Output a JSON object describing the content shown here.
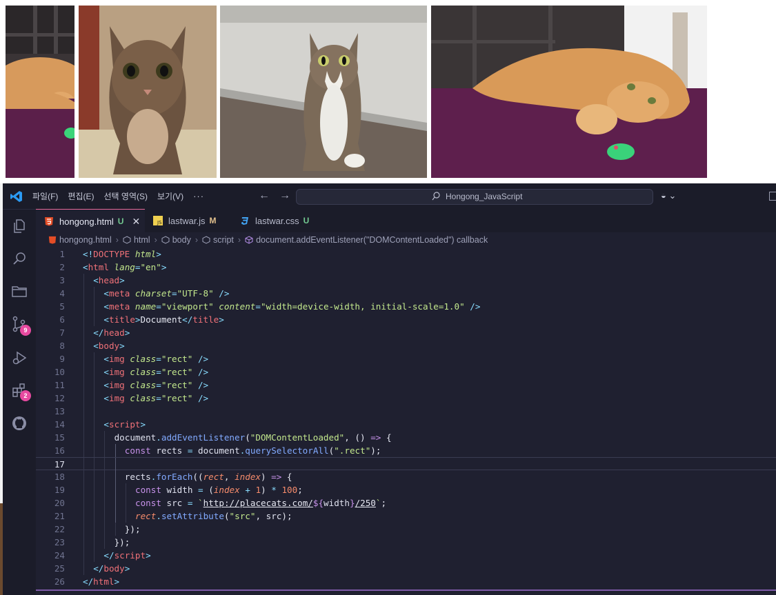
{
  "images": [
    {
      "alt": "orange cat lying on purple rug with green toy mouse (cropped)"
    },
    {
      "alt": "tabby cat looking at camera"
    },
    {
      "alt": "tabby and white cat sitting"
    },
    {
      "alt": "orange cat lying on purple rug with green toy mouse"
    }
  ],
  "titlebar": {
    "menu": [
      "파일(F)",
      "편집(E)",
      "선택 영역(S)",
      "보기(V)",
      "···"
    ],
    "command_center": "Hongong_JavaScript",
    "copilot_chevron": "⌄"
  },
  "activity_bar": {
    "source_control_badge": "9",
    "extensions_badge": "2"
  },
  "tabs": [
    {
      "label": "hongong.html",
      "status": "U",
      "status_color": "#73c991",
      "icon": "html5-icon",
      "active": true
    },
    {
      "label": "lastwar.js",
      "status": "M",
      "status_color": "#e2c08d",
      "icon": "js-icon",
      "active": false
    },
    {
      "label": "lastwar.css",
      "status": "U",
      "status_color": "#73c991",
      "icon": "css3-icon",
      "active": false
    }
  ],
  "breadcrumb": [
    "hongong.html",
    "html",
    "body",
    "script",
    "document.addEventListener(\"DOMContentLoaded\") callback"
  ],
  "colors": {
    "editor_bg": "#1f2030",
    "tag": "#f07178",
    "attribute": "#c3e88d",
    "keyword": "#c792ea",
    "function": "#82aaff",
    "accent": "#e76a9a"
  },
  "code": {
    "current_line": 17,
    "lines": [
      {
        "n": "1",
        "indent": 0,
        "tokens": [
          [
            "p",
            "<!"
          ],
          [
            "dt",
            "DOCTYPE"
          ],
          [
            "txt",
            " "
          ],
          [
            "attr",
            "html"
          ],
          [
            "p",
            ">"
          ]
        ]
      },
      {
        "n": "2",
        "indent": 0,
        "tokens": [
          [
            "p",
            "<"
          ],
          [
            "tag",
            "html"
          ],
          [
            "txt",
            " "
          ],
          [
            "attr",
            "lang"
          ],
          [
            "p",
            "="
          ],
          [
            "str",
            "\"en\""
          ],
          [
            "p",
            ">"
          ]
        ]
      },
      {
        "n": "3",
        "indent": 1,
        "tokens": [
          [
            "p",
            "<"
          ],
          [
            "tag",
            "head"
          ],
          [
            "p",
            ">"
          ]
        ]
      },
      {
        "n": "4",
        "indent": 2,
        "tokens": [
          [
            "p",
            "<"
          ],
          [
            "tag",
            "meta"
          ],
          [
            "txt",
            " "
          ],
          [
            "attr",
            "charset"
          ],
          [
            "p",
            "="
          ],
          [
            "str",
            "\"UTF-8\""
          ],
          [
            "txt",
            " "
          ],
          [
            "p",
            "/>"
          ]
        ]
      },
      {
        "n": "5",
        "indent": 2,
        "tokens": [
          [
            "p",
            "<"
          ],
          [
            "tag",
            "meta"
          ],
          [
            "txt",
            " "
          ],
          [
            "attr",
            "name"
          ],
          [
            "p",
            "="
          ],
          [
            "str",
            "\"viewport\""
          ],
          [
            "txt",
            " "
          ],
          [
            "attr",
            "content"
          ],
          [
            "p",
            "="
          ],
          [
            "str",
            "\"width=device-width, initial-scale=1.0\""
          ],
          [
            "txt",
            " "
          ],
          [
            "p",
            "/>"
          ]
        ]
      },
      {
        "n": "6",
        "indent": 2,
        "tokens": [
          [
            "p",
            "<"
          ],
          [
            "tag",
            "title"
          ],
          [
            "p",
            ">"
          ],
          [
            "txt",
            "Document"
          ],
          [
            "p",
            "</"
          ],
          [
            "tag",
            "title"
          ],
          [
            "p",
            ">"
          ]
        ]
      },
      {
        "n": "7",
        "indent": 1,
        "tokens": [
          [
            "p",
            "</"
          ],
          [
            "tag",
            "head"
          ],
          [
            "p",
            ">"
          ]
        ]
      },
      {
        "n": "8",
        "indent": 1,
        "tokens": [
          [
            "p",
            "<"
          ],
          [
            "tag",
            "body"
          ],
          [
            "p",
            ">"
          ]
        ]
      },
      {
        "n": "9",
        "indent": 2,
        "tokens": [
          [
            "p",
            "<"
          ],
          [
            "tag",
            "img"
          ],
          [
            "txt",
            " "
          ],
          [
            "attr",
            "class"
          ],
          [
            "p",
            "="
          ],
          [
            "str",
            "\"rect\""
          ],
          [
            "txt",
            " "
          ],
          [
            "p",
            "/>"
          ]
        ]
      },
      {
        "n": "10",
        "indent": 2,
        "tokens": [
          [
            "p",
            "<"
          ],
          [
            "tag",
            "img"
          ],
          [
            "txt",
            " "
          ],
          [
            "attr",
            "class"
          ],
          [
            "p",
            "="
          ],
          [
            "str",
            "\"rect\""
          ],
          [
            "txt",
            " "
          ],
          [
            "p",
            "/>"
          ]
        ]
      },
      {
        "n": "11",
        "indent": 2,
        "tokens": [
          [
            "p",
            "<"
          ],
          [
            "tag",
            "img"
          ],
          [
            "txt",
            " "
          ],
          [
            "attr",
            "class"
          ],
          [
            "p",
            "="
          ],
          [
            "str",
            "\"rect\""
          ],
          [
            "txt",
            " "
          ],
          [
            "p",
            "/>"
          ]
        ]
      },
      {
        "n": "12",
        "indent": 2,
        "tokens": [
          [
            "p",
            "<"
          ],
          [
            "tag",
            "img"
          ],
          [
            "txt",
            " "
          ],
          [
            "attr",
            "class"
          ],
          [
            "p",
            "="
          ],
          [
            "str",
            "\"rect\""
          ],
          [
            "txt",
            " "
          ],
          [
            "p",
            "/>"
          ]
        ]
      },
      {
        "n": "13",
        "indent": 2,
        "tokens": []
      },
      {
        "n": "14",
        "indent": 2,
        "tokens": [
          [
            "p",
            "<"
          ],
          [
            "tag",
            "script"
          ],
          [
            "p",
            ">"
          ]
        ]
      },
      {
        "n": "15",
        "indent": 3,
        "tokens": [
          [
            "id",
            "document"
          ],
          [
            "p",
            "."
          ],
          [
            "fn",
            "addEventListener"
          ],
          [
            "txt",
            "("
          ],
          [
            "str",
            "\"DOMContentLoaded\""
          ],
          [
            "txt",
            ", () "
          ],
          [
            "kw",
            "=>"
          ],
          [
            "txt",
            " {"
          ]
        ]
      },
      {
        "n": "16",
        "indent": 4,
        "tokens": [
          [
            "kw",
            "const"
          ],
          [
            "txt",
            " "
          ],
          [
            "id",
            "rects"
          ],
          [
            "txt",
            " "
          ],
          [
            "p",
            "="
          ],
          [
            "txt",
            " "
          ],
          [
            "id",
            "document"
          ],
          [
            "p",
            "."
          ],
          [
            "fn",
            "querySelectorAll"
          ],
          [
            "txt",
            "("
          ],
          [
            "str",
            "\".rect\""
          ],
          [
            "txt",
            ");"
          ]
        ]
      },
      {
        "n": "17",
        "indent": 4,
        "tokens": []
      },
      {
        "n": "18",
        "indent": 4,
        "tokens": [
          [
            "id",
            "rects"
          ],
          [
            "p",
            "."
          ],
          [
            "fn",
            "forEach"
          ],
          [
            "txt",
            "(("
          ],
          [
            "var",
            "rect"
          ],
          [
            "txt",
            ", "
          ],
          [
            "var",
            "index"
          ],
          [
            "txt",
            ") "
          ],
          [
            "kw",
            "=>"
          ],
          [
            "txt",
            " {"
          ]
        ]
      },
      {
        "n": "19",
        "indent": 5,
        "tokens": [
          [
            "kw",
            "const"
          ],
          [
            "txt",
            " "
          ],
          [
            "id",
            "width"
          ],
          [
            "txt",
            " "
          ],
          [
            "p",
            "="
          ],
          [
            "txt",
            " ("
          ],
          [
            "var",
            "index"
          ],
          [
            "txt",
            " "
          ],
          [
            "p",
            "+"
          ],
          [
            "txt",
            " "
          ],
          [
            "num",
            "1"
          ],
          [
            "txt",
            ") "
          ],
          [
            "p",
            "*"
          ],
          [
            "txt",
            " "
          ],
          [
            "num",
            "100"
          ],
          [
            "txt",
            ";"
          ]
        ]
      },
      {
        "n": "20",
        "indent": 5,
        "tokens": [
          [
            "kw",
            "const"
          ],
          [
            "txt",
            " "
          ],
          [
            "id",
            "src"
          ],
          [
            "txt",
            " "
          ],
          [
            "p",
            "="
          ],
          [
            "txt",
            " "
          ],
          [
            "str",
            "`"
          ],
          [
            "url",
            "http://placecats.com/"
          ],
          [
            "ip",
            "${"
          ],
          [
            "id",
            "width"
          ],
          [
            "ip",
            "}"
          ],
          [
            "url",
            "/250"
          ],
          [
            "str",
            "`"
          ],
          [
            "txt",
            ";"
          ]
        ]
      },
      {
        "n": "21",
        "indent": 5,
        "tokens": [
          [
            "var",
            "rect"
          ],
          [
            "p",
            "."
          ],
          [
            "fn",
            "setAttribute"
          ],
          [
            "txt",
            "("
          ],
          [
            "str",
            "\"src\""
          ],
          [
            "txt",
            ", "
          ],
          [
            "id",
            "src"
          ],
          [
            "txt",
            ");"
          ]
        ]
      },
      {
        "n": "22",
        "indent": 4,
        "tokens": [
          [
            "txt",
            "});"
          ]
        ]
      },
      {
        "n": "23",
        "indent": 3,
        "tokens": [
          [
            "txt",
            "});"
          ]
        ]
      },
      {
        "n": "24",
        "indent": 2,
        "tokens": [
          [
            "p",
            "</"
          ],
          [
            "tag",
            "script"
          ],
          [
            "p",
            ">"
          ]
        ]
      },
      {
        "n": "25",
        "indent": 1,
        "tokens": [
          [
            "p",
            "</"
          ],
          [
            "tag",
            "body"
          ],
          [
            "p",
            ">"
          ]
        ]
      },
      {
        "n": "26",
        "indent": 0,
        "tokens": [
          [
            "p",
            "</"
          ],
          [
            "tag",
            "html"
          ],
          [
            "p",
            ">"
          ]
        ]
      }
    ]
  }
}
